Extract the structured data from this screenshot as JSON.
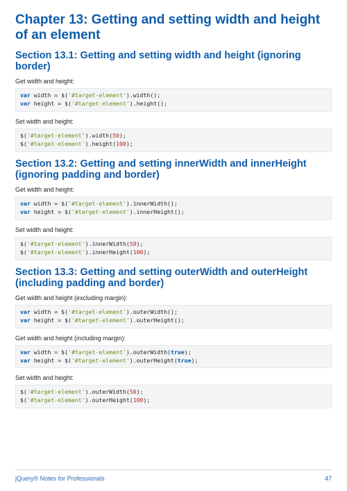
{
  "chapter": {
    "title": "Chapter 13: Getting and setting width and height of an element"
  },
  "sections": [
    {
      "heading": "Section 13.1: Getting and setting width and height (ignoring border)",
      "blocks": [
        {
          "type": "para",
          "text": "Get width and height:"
        },
        {
          "type": "code",
          "lines": [
            [
              {
                "t": "kw",
                "v": "var"
              },
              {
                "t": "txt",
                "v": " width = $("
              },
              {
                "t": "str",
                "v": "'#target-element'"
              },
              {
                "t": "txt",
                "v": ").width();"
              }
            ],
            [
              {
                "t": "kw",
                "v": "var"
              },
              {
                "t": "txt",
                "v": " height = $("
              },
              {
                "t": "str",
                "v": "'#target-element'"
              },
              {
                "t": "txt",
                "v": ").height();"
              }
            ]
          ]
        },
        {
          "type": "para",
          "text": "Set width and height:"
        },
        {
          "type": "code",
          "lines": [
            [
              {
                "t": "txt",
                "v": "$("
              },
              {
                "t": "str",
                "v": "'#target-element'"
              },
              {
                "t": "txt",
                "v": ").width("
              },
              {
                "t": "num",
                "v": "50"
              },
              {
                "t": "txt",
                "v": ");"
              }
            ],
            [
              {
                "t": "txt",
                "v": "$("
              },
              {
                "t": "str",
                "v": "'#target-element'"
              },
              {
                "t": "txt",
                "v": ").height("
              },
              {
                "t": "num",
                "v": "100"
              },
              {
                "t": "txt",
                "v": ");"
              }
            ]
          ]
        }
      ]
    },
    {
      "heading": "Section 13.2: Getting and setting innerWidth and innerHeight (ignoring padding and border)",
      "blocks": [
        {
          "type": "para",
          "text": "Get width and height:"
        },
        {
          "type": "code",
          "lines": [
            [
              {
                "t": "kw",
                "v": "var"
              },
              {
                "t": "txt",
                "v": " width = $("
              },
              {
                "t": "str",
                "v": "'#target-element'"
              },
              {
                "t": "txt",
                "v": ").innerWidth();"
              }
            ],
            [
              {
                "t": "kw",
                "v": "var"
              },
              {
                "t": "txt",
                "v": " height = $("
              },
              {
                "t": "str",
                "v": "'#target-element'"
              },
              {
                "t": "txt",
                "v": ").innerHeight();"
              }
            ]
          ]
        },
        {
          "type": "para",
          "text": "Set width and height:"
        },
        {
          "type": "code",
          "lines": [
            [
              {
                "t": "txt",
                "v": "$("
              },
              {
                "t": "str",
                "v": "'#target-element'"
              },
              {
                "t": "txt",
                "v": ").innerWidth("
              },
              {
                "t": "num",
                "v": "50"
              },
              {
                "t": "txt",
                "v": ");"
              }
            ],
            [
              {
                "t": "txt",
                "v": "$("
              },
              {
                "t": "str",
                "v": "'#target-element'"
              },
              {
                "t": "txt",
                "v": ").innerHeight("
              },
              {
                "t": "num",
                "v": "100"
              },
              {
                "t": "txt",
                "v": ");"
              }
            ]
          ]
        }
      ]
    },
    {
      "heading": "Section 13.3: Getting and setting outerWidth and outerHeight (including padding and border)",
      "blocks": [
        {
          "type": "para",
          "text": "Get width and height (excluding margin):"
        },
        {
          "type": "code",
          "lines": [
            [
              {
                "t": "kw",
                "v": "var"
              },
              {
                "t": "txt",
                "v": " width = $("
              },
              {
                "t": "str",
                "v": "'#target-element'"
              },
              {
                "t": "txt",
                "v": ").outerWidth();"
              }
            ],
            [
              {
                "t": "kw",
                "v": "var"
              },
              {
                "t": "txt",
                "v": " height = $("
              },
              {
                "t": "str",
                "v": "'#target-element'"
              },
              {
                "t": "txt",
                "v": ").outerHeight();"
              }
            ]
          ]
        },
        {
          "type": "para",
          "text": "Get width and height (including margin):"
        },
        {
          "type": "code",
          "lines": [
            [
              {
                "t": "kw",
                "v": "var"
              },
              {
                "t": "txt",
                "v": " width = $("
              },
              {
                "t": "str",
                "v": "'#target-element'"
              },
              {
                "t": "txt",
                "v": ").outerWidth("
              },
              {
                "t": "kw",
                "v": "true"
              },
              {
                "t": "txt",
                "v": ");"
              }
            ],
            [
              {
                "t": "kw",
                "v": "var"
              },
              {
                "t": "txt",
                "v": " height = $("
              },
              {
                "t": "str",
                "v": "'#target-element'"
              },
              {
                "t": "txt",
                "v": ").outerHeight("
              },
              {
                "t": "kw",
                "v": "true"
              },
              {
                "t": "txt",
                "v": ");"
              }
            ]
          ]
        },
        {
          "type": "para",
          "text": "Set width and height:"
        },
        {
          "type": "code",
          "lines": [
            [
              {
                "t": "txt",
                "v": "$("
              },
              {
                "t": "str",
                "v": "'#target-element'"
              },
              {
                "t": "txt",
                "v": ").outerWidth("
              },
              {
                "t": "num",
                "v": "50"
              },
              {
                "t": "txt",
                "v": ");"
              }
            ],
            [
              {
                "t": "txt",
                "v": "$("
              },
              {
                "t": "str",
                "v": "'#target-element'"
              },
              {
                "t": "txt",
                "v": ").outerHeight("
              },
              {
                "t": "num",
                "v": "100"
              },
              {
                "t": "txt",
                "v": ");"
              }
            ]
          ]
        }
      ]
    }
  ],
  "footer": {
    "left": "jQuery® Notes for Professionals",
    "right": "47"
  }
}
